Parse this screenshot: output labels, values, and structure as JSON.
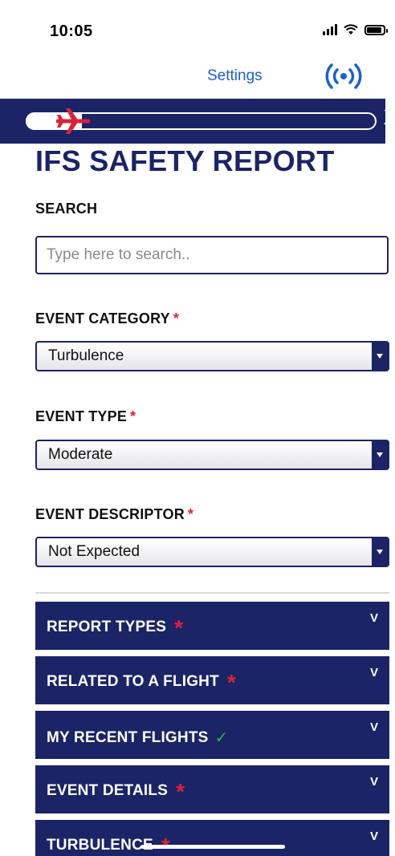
{
  "status_bar": {
    "time": "10:05"
  },
  "header": {
    "settings_label": "Settings",
    "broadcast_icon": "broadcast-icon"
  },
  "banner": {
    "progress_fraction": 0.16,
    "close_label": "X"
  },
  "page_title": "IFS SAFETY REPORT",
  "search": {
    "label": "SEARCH",
    "placeholder": "Type here to search.."
  },
  "event_category": {
    "label": "EVENT CATEGORY",
    "required": "*",
    "value": "Turbulence"
  },
  "event_type": {
    "label": "EVENT TYPE",
    "required": "*",
    "value": "Moderate"
  },
  "event_descriptor": {
    "label": "EVENT DESCRIPTOR",
    "required": "*",
    "value": "Not Expected"
  },
  "sections": [
    {
      "title": "REPORT TYPES",
      "status": "required",
      "marker": "*",
      "chevron": "V"
    },
    {
      "title": "RELATED TO A FLIGHT",
      "status": "required",
      "marker": "*",
      "chevron": "V"
    },
    {
      "title": "MY RECENT FLIGHTS",
      "status": "complete",
      "marker": "✓",
      "chevron": "V"
    },
    {
      "title": "EVENT DETAILS",
      "status": "required",
      "marker": "*",
      "chevron": "V"
    },
    {
      "title": "TURBULENCE",
      "status": "required",
      "marker": "*",
      "chevron": "V"
    }
  ],
  "colors": {
    "navy": "#1a2466",
    "link_blue": "#1a5fd6",
    "required_red": "#e0203a",
    "check_green": "#2bb24c"
  }
}
